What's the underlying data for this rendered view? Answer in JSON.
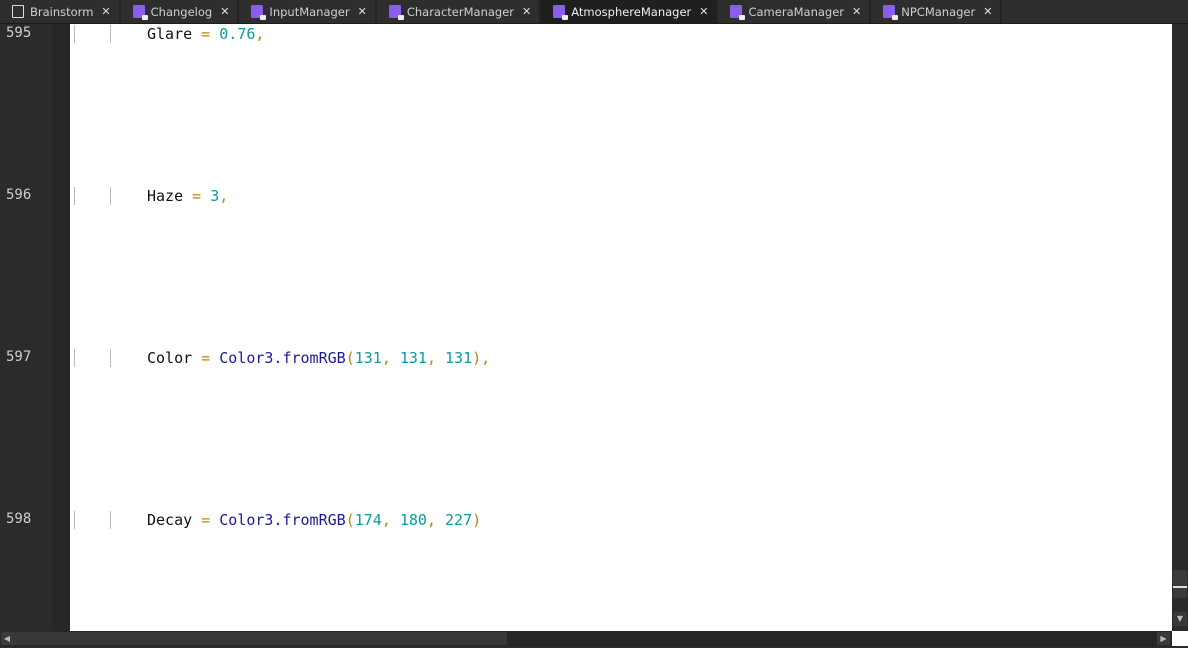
{
  "tabs": [
    {
      "label": "Brainstorm",
      "icon": "document-icon"
    },
    {
      "label": "Changelog",
      "icon": "script-icon"
    },
    {
      "label": "InputManager",
      "icon": "script-icon"
    },
    {
      "label": "CharacterManager",
      "icon": "script-icon"
    },
    {
      "label": "AtmosphereManager",
      "icon": "script-icon",
      "active": true
    },
    {
      "label": "CameraManager",
      "icon": "script-icon"
    },
    {
      "label": "NPCManager",
      "icon": "script-icon"
    }
  ],
  "close_glyph": "✕",
  "lines": [
    {
      "number": "595",
      "name": "Glare",
      "eq": " = ",
      "parts": [
        {
          "t": "0.76",
          "c": "num"
        },
        {
          "t": ",",
          "c": "op"
        }
      ]
    },
    {
      "number": "596",
      "name": "Haze",
      "eq": " = ",
      "parts": [
        {
          "t": "3",
          "c": "num"
        },
        {
          "t": ",",
          "c": "op"
        }
      ]
    },
    {
      "number": "597",
      "name": "Color",
      "eq": " = ",
      "parts": [
        {
          "t": "Color3.fromRGB",
          "c": "fn"
        },
        {
          "t": "(",
          "c": "op"
        },
        {
          "t": "131",
          "c": "num"
        },
        {
          "t": ", ",
          "c": "op"
        },
        {
          "t": "131",
          "c": "num"
        },
        {
          "t": ", ",
          "c": "op"
        },
        {
          "t": "131",
          "c": "num"
        },
        {
          "t": "),",
          "c": "op"
        }
      ]
    },
    {
      "number": "598",
      "name": "Decay",
      "eq": " = ",
      "parts": [
        {
          "t": "Color3.fromRGB",
          "c": "fn"
        },
        {
          "t": "(",
          "c": "op"
        },
        {
          "t": "174",
          "c": "num"
        },
        {
          "t": ", ",
          "c": "op"
        },
        {
          "t": "180",
          "c": "num"
        },
        {
          "t": ", ",
          "c": "op"
        },
        {
          "t": "227",
          "c": "num"
        },
        {
          "t": ")",
          "c": "op"
        }
      ]
    }
  ]
}
